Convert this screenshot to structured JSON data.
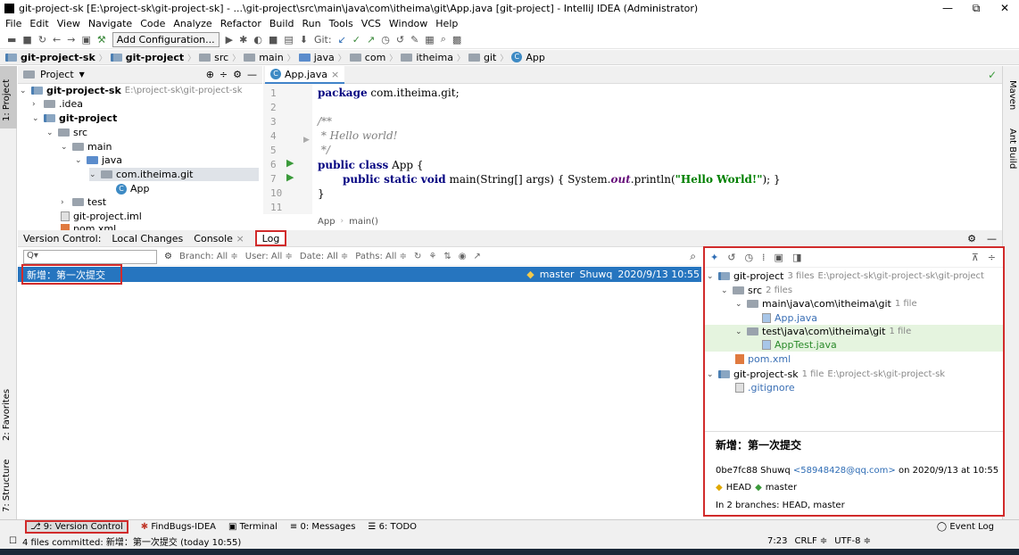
{
  "window": {
    "title": "git-project-sk [E:\\project-sk\\git-project-sk] - ...\\git-project\\src\\main\\java\\com\\itheima\\git\\App.java [git-project] - IntelliJ IDEA (Administrator)",
    "controls": [
      "—",
      "⧉",
      "✕"
    ]
  },
  "menu": [
    "File",
    "Edit",
    "View",
    "Navigate",
    "Code",
    "Analyze",
    "Refactor",
    "Build",
    "Run",
    "Tools",
    "VCS",
    "Window",
    "Help"
  ],
  "toolbar": {
    "add_config": "Add Configuration...",
    "git_label": "Git:"
  },
  "nav": [
    "git-project-sk",
    "git-project",
    "src",
    "main",
    "java",
    "com",
    "itheima",
    "git",
    "App"
  ],
  "left_strip": {
    "project": "1: Project",
    "favorites": "2: Favorites",
    "structure": "7: Structure"
  },
  "right_strip": {
    "maven": "Maven",
    "ant": "Ant Build"
  },
  "project_panel": {
    "header": "Project",
    "tree": [
      {
        "label": "git-project-sk",
        "hint": "E:\\project-sk\\git-project-sk"
      },
      {
        "label": ".idea"
      },
      {
        "label": "git-project"
      },
      {
        "label": "src"
      },
      {
        "label": "main"
      },
      {
        "label": "java"
      },
      {
        "label": "com.itheima.git"
      },
      {
        "label": "App"
      },
      {
        "label": "test"
      },
      {
        "label": "git-project.iml"
      },
      {
        "label": "pom.xml"
      }
    ]
  },
  "editor": {
    "tab": "App.java",
    "line_numbers": [
      "1",
      "2",
      "3",
      "4",
      "5",
      "6",
      "7",
      "10",
      "11"
    ],
    "code": {
      "l1_kw": "package",
      "l1_rest": " com.itheima.git;",
      "l3": "/**",
      "l4": " * Hello world!",
      "l5": " */",
      "l6_kw": "public class",
      "l6_rest": " App {",
      "l7_kw": "public static void",
      "l7_a": " main(String[] args) { System.",
      "l7_out": "out",
      "l7_b": ".println(",
      "l7_str": "\"Hello World!\"",
      "l7_c": "); }",
      "l10": "}"
    },
    "breadcrumb": [
      "App",
      "main()"
    ]
  },
  "vc_tabs": {
    "prefix": "Version Control:",
    "local": "Local Changes",
    "console": "Console",
    "log": "Log"
  },
  "filters": {
    "search_placeholder": "Q▾",
    "branch": "Branch: All ≑",
    "user": "User: All ≑",
    "date": "Date: All ≑",
    "paths": "Paths: All ≑"
  },
  "commit": {
    "message": "新增：第一次提交",
    "branch_tag": "master",
    "author": "Shuwq",
    "date": "2020/9/13 10:55"
  },
  "changes": {
    "tree": [
      {
        "label": "git-project",
        "count": "3 files",
        "path": "E:\\project-sk\\git-project-sk\\git-project"
      },
      {
        "label": "src",
        "count": "2 files"
      },
      {
        "label": "main\\java\\com\\itheima\\git",
        "count": "1 file"
      },
      {
        "label": "App.java"
      },
      {
        "label": "test\\java\\com\\itheima\\git",
        "count": "1 file"
      },
      {
        "label": "AppTest.java"
      },
      {
        "label": "pom.xml"
      },
      {
        "label": "git-project-sk",
        "count": "1 file",
        "path": "E:\\project-sk\\git-project-sk"
      },
      {
        "label": ".gitignore"
      }
    ],
    "details": {
      "message": "新增：第一次提交",
      "hash_author": "0be7fc88 Shuwq",
      "email": "<58948428@qq.com>",
      "date_text": "on 2020/9/13 at 10:55",
      "head": "HEAD",
      "branch": "master",
      "branches": "In 2 branches: HEAD, master"
    }
  },
  "bottom_tabs": {
    "vc": "9: Version Control",
    "findbugs": "FindBugs-IDEA",
    "terminal": "Terminal",
    "messages": "0: Messages",
    "todo": "6: TODO",
    "eventlog": "Event Log"
  },
  "status": {
    "left": "4 files committed: 新增：第一次提交 (today 10:55)",
    "pos": "7:23",
    "crlf": "CRLF ≑",
    "enc": "UTF-8 ≑"
  },
  "colors": {
    "accent": "#2675bf",
    "highlight": "#d12b2b"
  }
}
